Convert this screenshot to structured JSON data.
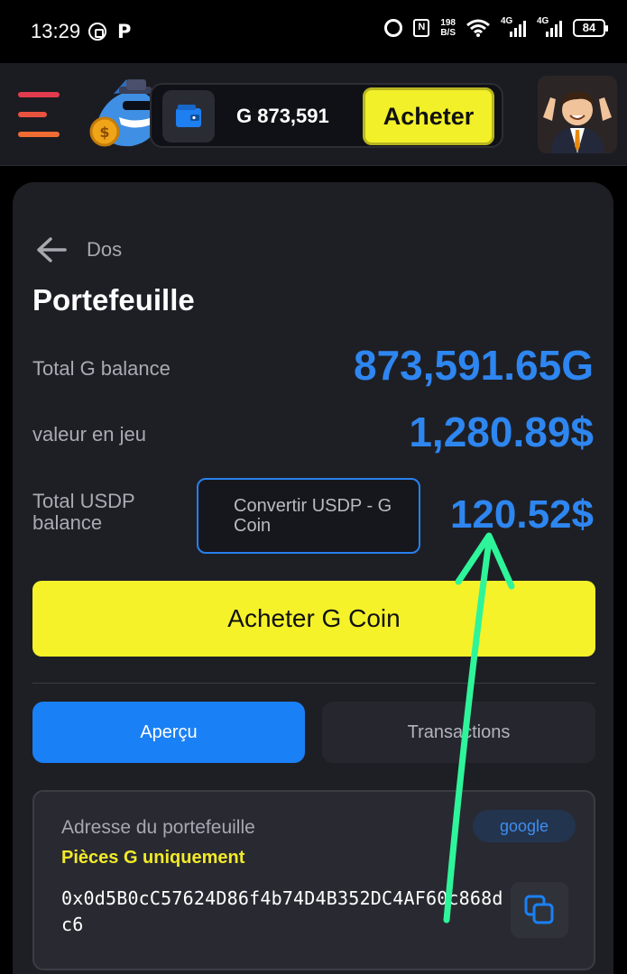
{
  "status_bar": {
    "time": "13:29",
    "app_icons": [
      "whatsapp-icon",
      "p-icon"
    ],
    "net_speed_value": "198",
    "net_speed_unit": "B/S",
    "network_1": "4G",
    "network_2": "4G",
    "battery": "84"
  },
  "header": {
    "wallet_balance": "G 873,591",
    "buy_label": "Acheter"
  },
  "wallet": {
    "back_label": "Dos",
    "title": "Portefeuille",
    "rows": [
      {
        "label": "Total G balance",
        "value": "873,591.65G"
      },
      {
        "label": "valeur en jeu",
        "value": "1,280.89$"
      },
      {
        "label": "Total USDP balance",
        "value": "120.52$"
      }
    ],
    "convert_label": "Convertir USDP - G Coin",
    "buy_coin_label": "Acheter G Coin"
  },
  "tabs": [
    {
      "label": "Aperçu",
      "active": true
    },
    {
      "label": "Transactions",
      "active": false
    }
  ],
  "address_card": {
    "label": "Adresse du portefeuille",
    "badge": "google",
    "note": "Pièces G uniquement",
    "address": "0x0d5B0cC57624D86f4b74D4B352DC4AF60c868dc6"
  },
  "colors": {
    "accent_blue": "#2e86f0",
    "accent_yellow": "#f5f22a",
    "annotation_arrow": "#2ef59a",
    "background": "#1e1f25"
  }
}
